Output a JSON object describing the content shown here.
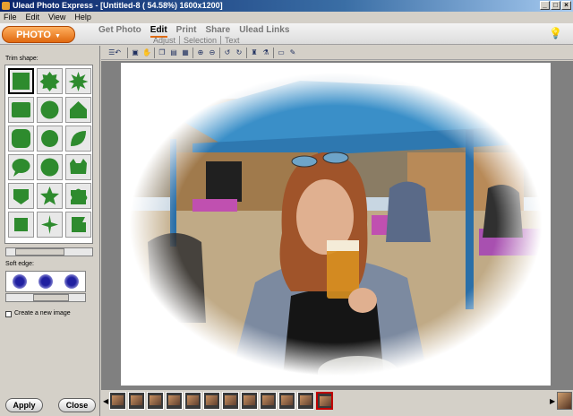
{
  "window": {
    "title": "Ulead Photo Express - [Untitled-8 ( 54.58%) 1600x1200]"
  },
  "menu": [
    "File",
    "Edit",
    "View",
    "Help"
  ],
  "mode": {
    "photo_label": "PHOTO",
    "tabs": [
      "Get Photo",
      "Edit",
      "Print",
      "Share",
      "Ulead Links"
    ],
    "active_tab": "Edit",
    "subtabs": [
      "Adjust",
      "Selection",
      "Text"
    ]
  },
  "panel": {
    "trim_label": "Trim shape:",
    "soft_label": "Soft edge:",
    "checkbox_label": "Create a new image",
    "apply_label": "Apply",
    "close_label": "Close"
  },
  "colors": {
    "accent": "#e06a10",
    "shape_green": "#2e8b2e",
    "selected_frame": "#c00000"
  },
  "filmstrip": {
    "count": 12,
    "selected_index": 11
  }
}
